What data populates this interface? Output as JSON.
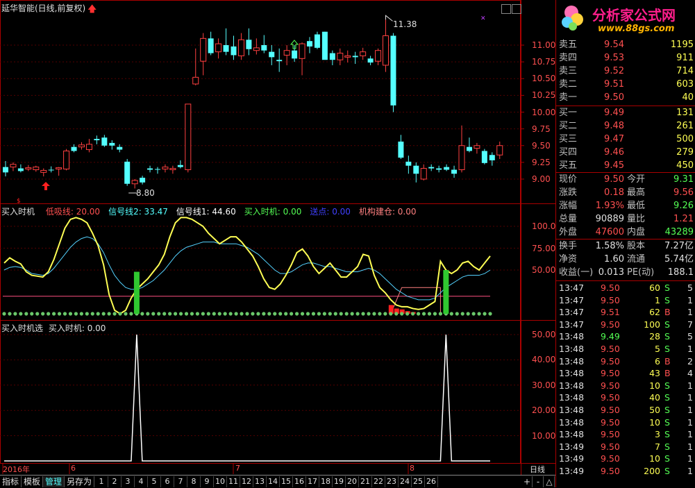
{
  "main": {
    "title": "延华智能(日线,前复权)",
    "high_label": "11.38",
    "low_label": "8.80",
    "price_axis": [
      "11.00",
      "10.75",
      "10.50",
      "10.25",
      "10.00",
      "9.75",
      "9.50",
      "9.25",
      "9.00"
    ]
  },
  "indicator1": {
    "name": "买入时机",
    "items": [
      {
        "label": "低吸线: 20.00",
        "color": "#ff5050"
      },
      {
        "label": "信号线2: 33.47",
        "color": "#54ffff"
      },
      {
        "label": "信号线1: 44.60",
        "color": "#ffffff"
      },
      {
        "label": "买入时机: 0.00",
        "color": "#54ff54"
      },
      {
        "label": "送点: 0.00",
        "color": "#4040ff"
      },
      {
        "label": "机构建仓: 0.00",
        "color": "#ff8080"
      }
    ],
    "axis": [
      "100.0",
      "75.00",
      "50.00"
    ]
  },
  "indicator2": {
    "name": "买入时机选",
    "value": "买入时机: 0.00",
    "axis": [
      "50.00",
      "40.00",
      "30.00",
      "20.00",
      "10.00"
    ]
  },
  "xaxis": {
    "labels": [
      "2016年",
      "6",
      "7",
      "8"
    ],
    "period": "日线"
  },
  "bottom": {
    "tabs": [
      "指标",
      "模板",
      "管理",
      "另存为"
    ],
    "pages": [
      "1",
      "2",
      "3",
      "4",
      "5",
      "6",
      "7",
      "8",
      "9",
      "10",
      "11",
      "12",
      "13",
      "14",
      "15",
      "16",
      "17",
      "18",
      "19",
      "20",
      "21",
      "22",
      "23",
      "24",
      "25",
      "26"
    ],
    "controls": [
      "+",
      "-",
      "△"
    ]
  },
  "quote": {
    "logo_text": "分析家公式网",
    "logo_url": "www.88gs.com",
    "asks": [
      {
        "label": "卖五",
        "price": "9.54",
        "vol": "1195"
      },
      {
        "label": "卖四",
        "price": "9.53",
        "vol": "911"
      },
      {
        "label": "卖三",
        "price": "9.52",
        "vol": "714"
      },
      {
        "label": "卖二",
        "price": "9.51",
        "vol": "603"
      },
      {
        "label": "卖一",
        "price": "9.50",
        "vol": "40"
      }
    ],
    "bids": [
      {
        "label": "买一",
        "price": "9.49",
        "vol": "131"
      },
      {
        "label": "买二",
        "price": "9.48",
        "vol": "261"
      },
      {
        "label": "买三",
        "price": "9.47",
        "vol": "500"
      },
      {
        "label": "买四",
        "price": "9.46",
        "vol": "279"
      },
      {
        "label": "买五",
        "price": "9.45",
        "vol": "450"
      }
    ],
    "stats": [
      {
        "l1": "现价",
        "v1": "9.50",
        "c1": "up",
        "l2": "今开",
        "v2": "9.31",
        "c2": "dn"
      },
      {
        "l1": "涨跌",
        "v1": "0.18",
        "c1": "up",
        "l2": "最高",
        "v2": "9.56",
        "c2": "up"
      },
      {
        "l1": "涨幅",
        "v1": "1.93%",
        "c1": "up",
        "l2": "最低",
        "v2": "9.26",
        "c2": "dn"
      },
      {
        "l1": "总量",
        "v1": "90889",
        "c1": "wh",
        "l2": "量比",
        "v2": "1.21",
        "c2": "up"
      },
      {
        "l1": "外盘",
        "v1": "47600",
        "c1": "up",
        "l2": "内盘",
        "v2": "43289",
        "c2": "dn"
      }
    ],
    "stats2": [
      {
        "l1": "换手",
        "v1": "1.58%",
        "l2": "股本",
        "v2": "7.27亿"
      },
      {
        "l1": "净资",
        "v1": "1.60",
        "l2": "流通",
        "v2": "5.74亿"
      },
      {
        "l1": "收益(一)",
        "v1": "0.013",
        "l2": "PE(动)",
        "v2": "188.1"
      }
    ],
    "ticks": [
      {
        "time": "13:47",
        "price": "9.50",
        "vol": "60",
        "side": "S",
        "cnt": "5"
      },
      {
        "time": "13:47",
        "price": "9.50",
        "vol": "1",
        "side": "S",
        "cnt": "1"
      },
      {
        "time": "13:47",
        "price": "9.51",
        "vol": "62",
        "side": "B",
        "cnt": "1"
      },
      {
        "time": "13:47",
        "price": "9.50",
        "vol": "100",
        "side": "S",
        "cnt": "7"
      },
      {
        "time": "13:48",
        "price": "9.49",
        "vol": "28",
        "side": "S",
        "cnt": "5"
      },
      {
        "time": "13:48",
        "price": "9.50",
        "vol": "5",
        "side": "S",
        "cnt": "1"
      },
      {
        "time": "13:48",
        "price": "9.50",
        "vol": "6",
        "side": "B",
        "cnt": "2"
      },
      {
        "time": "13:48",
        "price": "9.50",
        "vol": "43",
        "side": "B",
        "cnt": "4"
      },
      {
        "time": "13:48",
        "price": "9.50",
        "vol": "10",
        "side": "S",
        "cnt": "1"
      },
      {
        "time": "13:48",
        "price": "9.50",
        "vol": "40",
        "side": "S",
        "cnt": "1"
      },
      {
        "time": "13:48",
        "price": "9.50",
        "vol": "50",
        "side": "S",
        "cnt": "1"
      },
      {
        "time": "13:48",
        "price": "9.50",
        "vol": "10",
        "side": "S",
        "cnt": "1"
      },
      {
        "time": "13:48",
        "price": "9.50",
        "vol": "3",
        "side": "S",
        "cnt": "1"
      },
      {
        "time": "13:49",
        "price": "9.50",
        "vol": "7",
        "side": "S",
        "cnt": "1"
      },
      {
        "time": "13:49",
        "price": "9.50",
        "vol": "10",
        "side": "S",
        "cnt": "1"
      },
      {
        "time": "13:49",
        "price": "9.50",
        "vol": "200",
        "side": "S",
        "cnt": "1"
      }
    ]
  },
  "chart_data": {
    "type": "candlestick",
    "ohlc": [
      [
        9.18,
        9.27,
        9.04,
        9.1
      ],
      [
        9.18,
        9.25,
        9.12,
        9.22
      ],
      [
        9.16,
        9.22,
        9.1,
        9.12
      ],
      [
        9.15,
        9.21,
        9.12,
        9.17
      ],
      [
        9.14,
        9.2,
        9.11,
        9.18
      ],
      [
        9.1,
        9.16,
        9.04,
        9.13
      ],
      [
        9.14,
        9.19,
        9.1,
        9.13
      ],
      [
        9.15,
        9.18,
        9.05,
        9.17
      ],
      [
        9.15,
        9.45,
        9.13,
        9.42
      ],
      [
        9.48,
        9.52,
        9.4,
        9.42
      ],
      [
        9.48,
        9.55,
        9.44,
        9.51
      ],
      [
        9.44,
        9.6,
        9.4,
        9.52
      ],
      [
        9.6,
        9.65,
        9.52,
        9.58
      ],
      [
        9.62,
        9.66,
        9.48,
        9.5
      ],
      [
        9.54,
        9.58,
        9.44,
        9.5
      ],
      [
        9.48,
        9.52,
        9.4,
        9.44
      ],
      [
        9.26,
        9.3,
        8.9,
        8.93
      ],
      [
        8.93,
        9.0,
        8.86,
        8.98
      ],
      [
        9.02,
        9.05,
        8.92,
        8.95
      ],
      [
        9.16,
        9.2,
        9.1,
        9.14
      ],
      [
        9.15,
        9.18,
        9.08,
        9.14
      ],
      [
        9.15,
        9.22,
        9.1,
        9.18
      ],
      [
        9.14,
        9.2,
        9.08,
        9.16
      ],
      [
        9.21,
        9.28,
        9.16,
        9.18
      ],
      [
        9.14,
        10.12,
        9.1,
        10.12
      ],
      [
        10.42,
        10.95,
        10.4,
        10.52
      ],
      [
        10.76,
        11.18,
        10.55,
        11.1
      ],
      [
        11.1,
        11.2,
        10.85,
        10.88
      ],
      [
        10.9,
        11.1,
        10.8,
        11.02
      ],
      [
        11.0,
        11.25,
        10.85,
        10.9
      ],
      [
        10.98,
        11.14,
        10.78,
        10.85
      ],
      [
        10.84,
        11.18,
        10.78,
        11.08
      ],
      [
        11.08,
        11.25,
        10.85,
        10.94
      ],
      [
        10.92,
        11.1,
        10.86,
        10.96
      ],
      [
        11.0,
        11.15,
        10.88,
        10.92
      ],
      [
        10.9,
        11.0,
        10.7,
        10.82
      ],
      [
        10.78,
        10.95,
        10.6,
        10.76
      ],
      [
        10.85,
        11.0,
        10.7,
        10.92
      ],
      [
        10.92,
        11.0,
        10.75,
        10.8
      ],
      [
        10.8,
        11.04,
        10.55,
        11.02
      ],
      [
        11.06,
        11.12,
        10.88,
        10.98
      ],
      [
        11.16,
        11.2,
        10.94,
        10.96
      ],
      [
        11.2,
        11.2,
        10.8,
        10.78
      ],
      [
        10.88,
        10.92,
        10.7,
        10.78
      ],
      [
        10.78,
        10.95,
        10.7,
        10.88
      ],
      [
        10.82,
        10.92,
        10.74,
        10.84
      ],
      [
        10.84,
        10.9,
        10.72,
        10.82
      ],
      [
        10.84,
        10.96,
        10.78,
        10.9
      ],
      [
        10.8,
        10.84,
        10.7,
        10.74
      ],
      [
        10.76,
        10.95,
        10.7,
        10.92
      ],
      [
        10.7,
        11.38,
        10.6,
        11.14
      ],
      [
        11.14,
        11.18,
        10.0,
        10.1
      ],
      [
        9.56,
        9.66,
        9.3,
        9.32
      ],
      [
        9.26,
        9.35,
        9.08,
        9.2
      ],
      [
        9.2,
        9.25,
        8.95,
        9.08
      ],
      [
        9.0,
        9.22,
        8.98,
        9.16
      ],
      [
        9.18,
        9.22,
        9.12,
        9.16
      ],
      [
        9.16,
        9.2,
        9.1,
        9.14
      ],
      [
        9.18,
        9.22,
        9.12,
        9.14
      ],
      [
        9.14,
        9.2,
        9.02,
        9.08
      ],
      [
        9.14,
        9.8,
        9.1,
        9.5
      ],
      [
        9.48,
        9.62,
        9.4,
        9.42
      ],
      [
        9.46,
        9.54,
        9.38,
        9.5
      ],
      [
        9.42,
        9.45,
        9.22,
        9.24
      ],
      [
        9.36,
        9.4,
        9.2,
        9.28
      ],
      [
        9.36,
        9.56,
        9.3,
        9.5
      ]
    ],
    "indicator1": {
      "yellow": [
        58,
        64,
        60,
        57,
        48,
        44,
        43,
        42,
        48,
        62,
        80,
        98,
        108,
        110,
        108,
        104,
        92,
        78,
        56,
        22,
        4,
        0,
        4,
        18,
        28,
        34,
        40,
        48,
        56,
        68,
        88,
        104,
        110,
        110,
        108,
        104,
        100,
        92,
        86,
        80,
        84,
        88,
        88,
        82,
        74,
        66,
        54,
        40,
        30,
        28,
        34,
        44,
        56,
        70,
        74,
        66,
        54,
        46,
        52,
        58,
        50,
        42,
        42,
        48,
        54,
        68,
        66,
        44,
        30,
        24,
        16,
        10,
        8,
        8,
        6,
        5,
        6,
        10,
        14,
        60,
        50,
        46,
        50,
        58,
        60,
        54,
        50,
        58,
        66
      ],
      "cyan": [
        50,
        53,
        54,
        53,
        50,
        46,
        45,
        44,
        46,
        52,
        60,
        68,
        76,
        82,
        86,
        88,
        86,
        80,
        70,
        56,
        44,
        36,
        30,
        28,
        28,
        30,
        34,
        38,
        44,
        50,
        58,
        66,
        72,
        76,
        78,
        80,
        82,
        82,
        82,
        80,
        80,
        80,
        80,
        78,
        76,
        72,
        68,
        62,
        56,
        50,
        46,
        46,
        48,
        52,
        56,
        58,
        58,
        56,
        54,
        54,
        52,
        50,
        48,
        48,
        48,
        50,
        52,
        50,
        46,
        40,
        34,
        28,
        24,
        20,
        18,
        16,
        16,
        16,
        18,
        24,
        30,
        34,
        38,
        42,
        44,
        44,
        44,
        46,
        50
      ],
      "low_line": 20,
      "green_bars": [
        [
          24,
          0,
          48
        ],
        [
          80,
          0,
          50
        ]
      ]
    },
    "indicator2": {
      "spikes": [
        [
          24,
          50
        ],
        [
          80,
          50
        ]
      ]
    }
  }
}
